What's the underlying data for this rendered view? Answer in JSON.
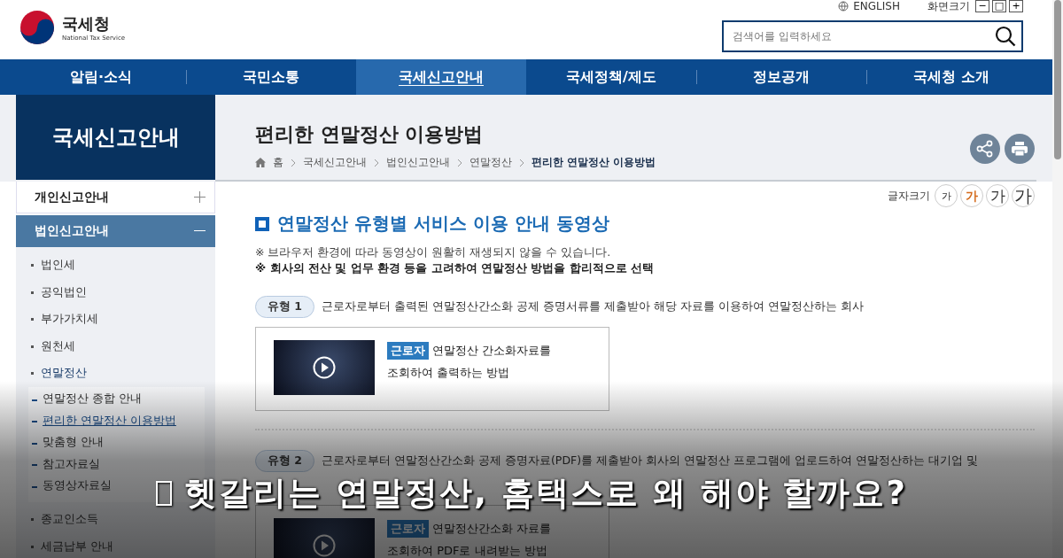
{
  "header": {
    "logo_text": "국세청",
    "logo_subtext": "National Tax Service",
    "language_link": "ENGLISH",
    "zoom_label": "화면크기",
    "zoom_buttons": [
      "−",
      "□",
      "+"
    ],
    "search": {
      "placeholder": "검색어를 입력하세요"
    }
  },
  "nav": [
    {
      "label": "알림·소식",
      "selected": false
    },
    {
      "label": "국민소통",
      "selected": false
    },
    {
      "label": "국세신고안내",
      "selected": true
    },
    {
      "label": "국세정책/제도",
      "selected": false
    },
    {
      "label": "정보공개",
      "selected": false
    },
    {
      "label": "국세청 소개",
      "selected": false
    }
  ],
  "sidebar": {
    "title": "국세신고안내",
    "items": [
      {
        "label": "개인신고안내",
        "expanded": false
      },
      {
        "label": "법인신고안내",
        "expanded": true,
        "children": [
          {
            "label": "법인세",
            "expanded": false
          },
          {
            "label": "공익법인",
            "expanded": false
          },
          {
            "label": "부가가치세",
            "expanded": false
          },
          {
            "label": "원천세",
            "expanded": false
          },
          {
            "label": "연말정산",
            "expanded": true,
            "children": [
              {
                "label": "연말정산 종합 안내",
                "selected": false
              },
              {
                "label": "편리한 연말정산 이용방법",
                "selected": true
              },
              {
                "label": "맞춤형 안내",
                "selected": false
              },
              {
                "label": "참고자료실",
                "selected": false
              },
              {
                "label": "동영상자료실",
                "selected": false
              }
            ]
          },
          {
            "label": "종교인소득",
            "expanded": false
          },
          {
            "label": "세금납부 안내",
            "expanded": false
          }
        ]
      }
    ]
  },
  "page": {
    "title": "편리한 연말정산 이용방법",
    "breadcrumb": [
      "홈",
      "국세신고안내",
      "법인신고안내",
      "연말정산",
      "편리한 연말정산 이용방법"
    ],
    "font_size": {
      "label": "글자크기",
      "options": [
        {
          "label": "가",
          "selected": false
        },
        {
          "label": "가",
          "selected": true
        },
        {
          "label": "가",
          "selected": false
        },
        {
          "label": "가",
          "selected": false
        }
      ]
    },
    "section_title": "연말정산 유형별 서비스 이용 안내 동영상",
    "notes": [
      {
        "text": "※ 브라우저 환경에 따라 동영상이 원활히 재생되지 않을 수 있습니다.",
        "emphasis": false
      },
      {
        "text": "※ 회사의 전산 및 업무 환경 등을 고려하여 연말정산 방법을 합리적으로 선택",
        "emphasis": true
      }
    ],
    "types": [
      {
        "badge": "유형 1",
        "description": "근로자로부터 출력된 연말정산간소화 공제 증명서류를 제출받아 해당 자료를 이용하여 연말정산하는 회사",
        "video": {
          "tag": "근로자",
          "lines": [
            "연말정산 간소화자료를",
            "조회하여 출력하는 방법"
          ]
        }
      },
      {
        "badge": "유형 2",
        "description": "근로자로부터 연말정산간소화 공제 증명자료(PDF)를 제출받아 회사의 연말정산 프로그램에 업로드하여 연말정산하는 대기업 및",
        "video": {
          "tag": "근로자",
          "lines": [
            "연말정산간소화 자료를",
            "조회하여 PDF로 내려받는 방법"
          ]
        }
      }
    ]
  },
  "caption": {
    "text": "헷갈리는 연말정산, 홈택스로 왜 해야 할까요?"
  }
}
